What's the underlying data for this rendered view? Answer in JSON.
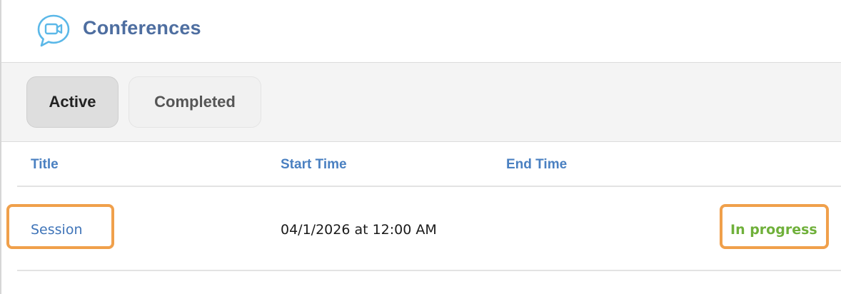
{
  "header": {
    "title": "Conferences",
    "icon": "video-chat-icon",
    "accent_color": "#4e6ea0"
  },
  "tabs": [
    {
      "label": "Active",
      "selected": true
    },
    {
      "label": "Completed",
      "selected": false
    }
  ],
  "table": {
    "columns": [
      "Title",
      "Start Time",
      "End Time"
    ],
    "rows": [
      {
        "title": "Session",
        "start_time": "04/1/2026 at 12:00 AM",
        "end_time": "",
        "status": "In progress"
      }
    ]
  },
  "colors": {
    "link": "#3f74b8",
    "column_header": "#4a80c1",
    "status_in_progress": "#6fb03a",
    "highlight": "#f0a04b"
  }
}
